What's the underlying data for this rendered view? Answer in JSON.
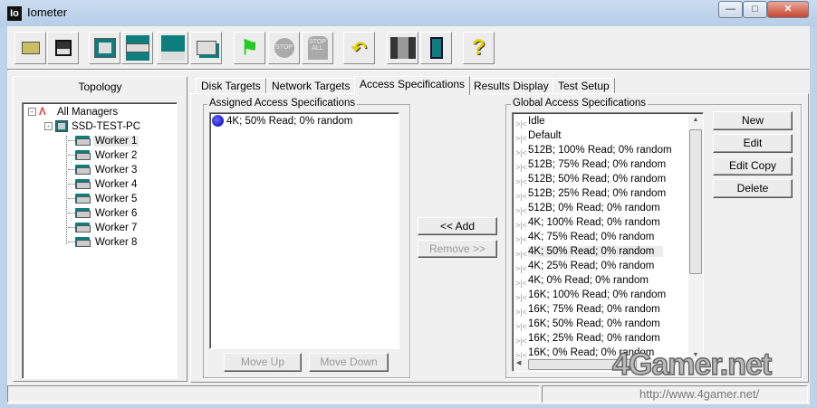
{
  "window": {
    "title": "Iometer",
    "logo": "Io",
    "controls": [
      "minimize",
      "maximize",
      "close"
    ]
  },
  "toolbar": [
    {
      "name": "open-icon"
    },
    {
      "name": "save-icon"
    },
    {
      "name": "manager-icon"
    },
    {
      "name": "worker-icon"
    },
    {
      "name": "network-worker-icon"
    },
    {
      "name": "duplicate-worker-icon"
    },
    {
      "name": "start-flag-icon"
    },
    {
      "name": "stop-icon"
    },
    {
      "name": "stop-all-icon"
    },
    {
      "name": "reset-icon"
    },
    {
      "name": "disconnect-icon"
    },
    {
      "name": "exit-icon"
    },
    {
      "name": "help-icon"
    }
  ],
  "topology": {
    "title": "Topology",
    "root": "All Managers",
    "manager": "SSD-TEST-PC",
    "workers": [
      "Worker 1",
      "Worker 2",
      "Worker 3",
      "Worker 4",
      "Worker 5",
      "Worker 6",
      "Worker 7",
      "Worker 8"
    ],
    "selected": "Worker 1"
  },
  "tabs": [
    "Disk Targets",
    "Network Targets",
    "Access Specifications",
    "Results Display",
    "Test Setup"
  ],
  "active_tab": "Access Specifications",
  "assigned": {
    "label": "Assigned Access Specifications",
    "items": [
      "4K; 50% Read; 0% random"
    ],
    "move_up": "Move Up",
    "move_down": "Move Down"
  },
  "add_label": "<< Add",
  "remove_label": "Remove >>",
  "global": {
    "label": "Global Access Specifications",
    "items": [
      "Idle",
      "Default",
      "512B; 100% Read; 0% random",
      "512B; 75% Read; 0% random",
      "512B; 50% Read; 0% random",
      "512B; 25% Read; 0% random",
      "512B; 0% Read; 0% random",
      "4K; 100% Read; 0% random",
      "4K; 75% Read; 0% random",
      "4K; 50% Read; 0% random",
      "4K; 25% Read; 0% random",
      "4K; 0% Read; 0% random",
      "16K; 100% Read; 0% random",
      "16K; 75% Read; 0% random",
      "16K; 50% Read; 0% random",
      "16K; 25% Read; 0% random",
      "16K; 0% Read; 0% random"
    ],
    "highlighted": "4K; 50% Read; 0% random"
  },
  "buttons": {
    "new": "New",
    "edit": "Edit",
    "edit_copy": "Edit Copy",
    "delete": "Delete"
  },
  "watermark": {
    "logo": "4Gamer.net",
    "url": "http://www.4gamer.net/"
  }
}
